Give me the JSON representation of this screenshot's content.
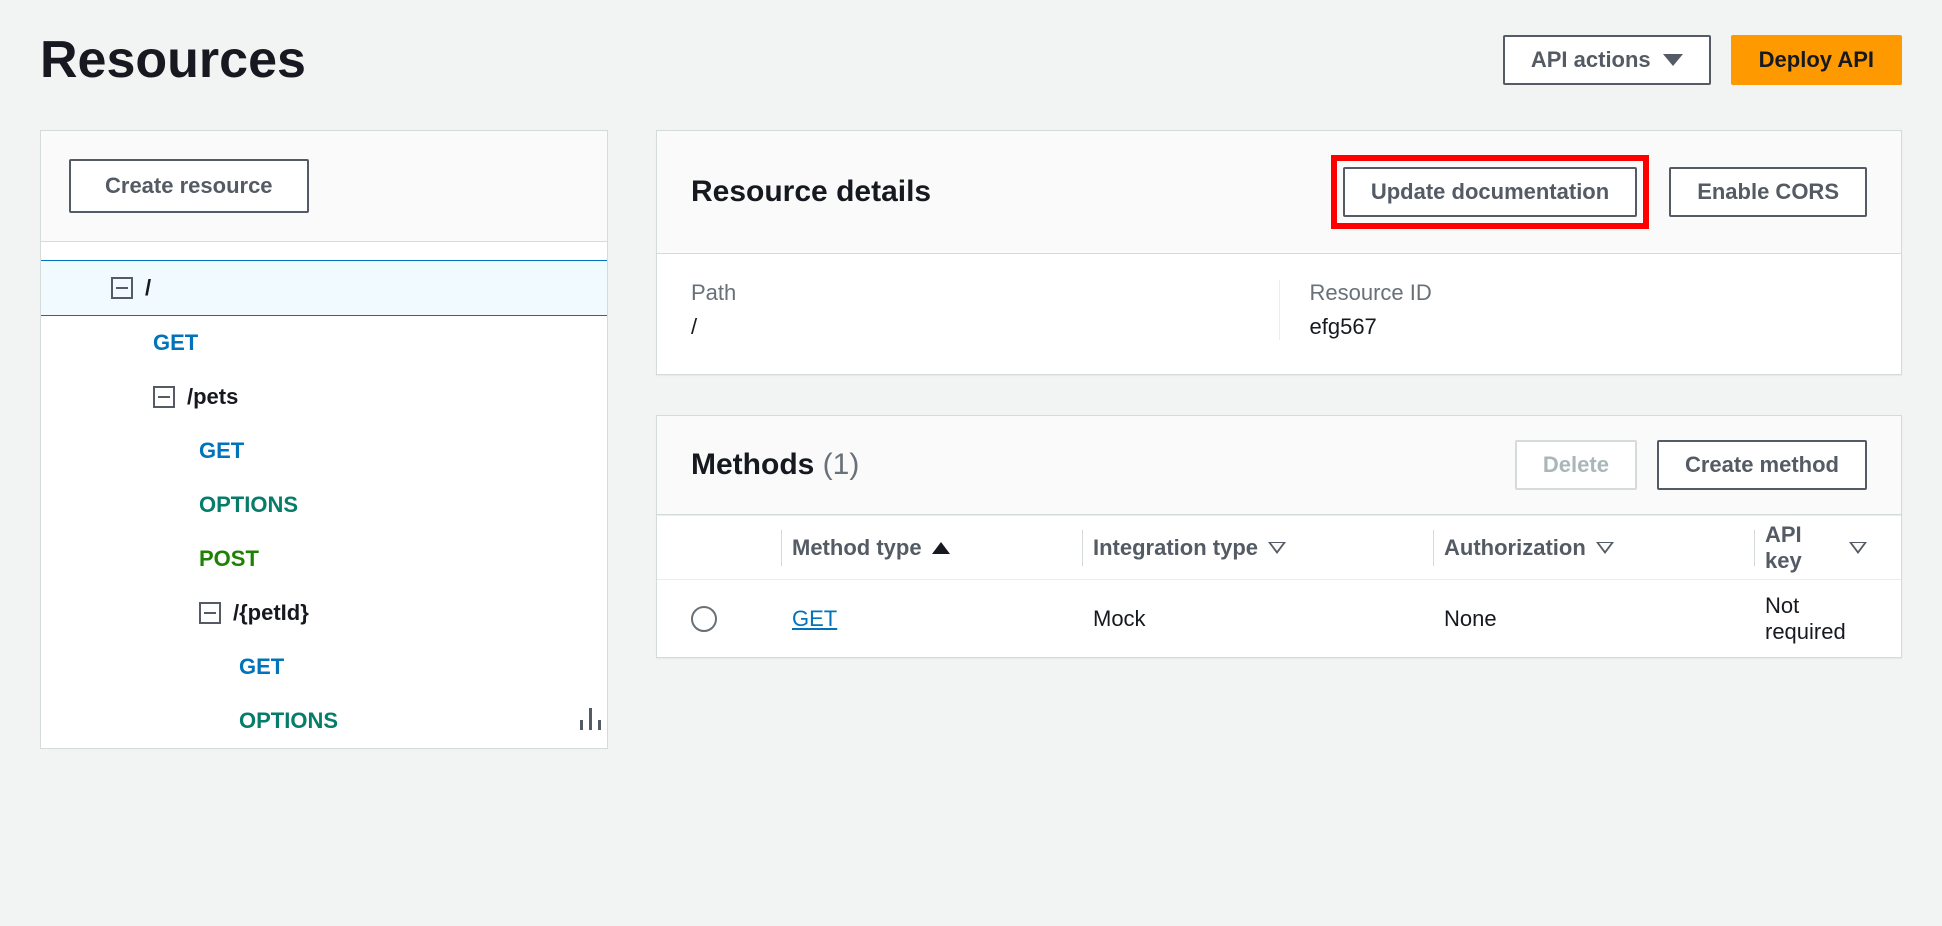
{
  "header": {
    "title": "Resources",
    "api_actions_label": "API actions",
    "deploy_label": "Deploy API"
  },
  "sidebar": {
    "create_resource_label": "Create resource",
    "tree": {
      "root": "/",
      "root_get": "GET",
      "pets": "/pets",
      "pets_get": "GET",
      "pets_options": "OPTIONS",
      "pets_post": "POST",
      "petid": "/{petId}",
      "petid_get": "GET",
      "petid_options": "OPTIONS"
    }
  },
  "details": {
    "title": "Resource details",
    "update_doc_label": "Update documentation",
    "enable_cors_label": "Enable CORS",
    "path_label": "Path",
    "path_value": "/",
    "resource_id_label": "Resource ID",
    "resource_id_value": "efg567"
  },
  "methods": {
    "title": "Methods",
    "count": "(1)",
    "delete_label": "Delete",
    "create_label": "Create method",
    "columns": {
      "method_type": "Method type",
      "integration_type": "Integration type",
      "authorization": "Authorization",
      "api_key": "API key"
    },
    "rows": [
      {
        "method": "GET",
        "integration": "Mock",
        "authorization": "None",
        "api_key": "Not required"
      }
    ]
  }
}
